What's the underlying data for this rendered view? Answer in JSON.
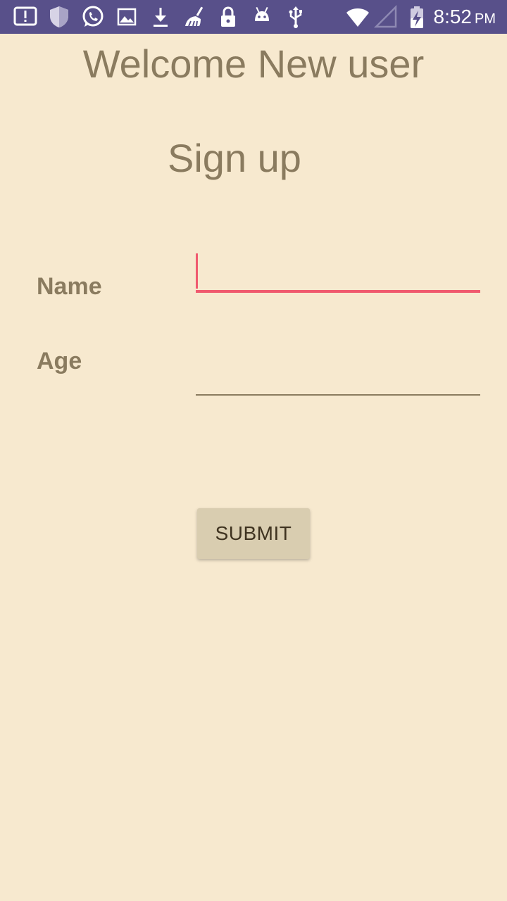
{
  "status_bar": {
    "icons": [
      "alert-icon",
      "shield-icon",
      "whatsapp-icon",
      "image-icon",
      "download-icon",
      "cleaner-icon",
      "lock-icon",
      "android-icon",
      "usb-icon",
      "wifi-icon",
      "signal-icon",
      "battery-charging-icon"
    ],
    "time": "8:52",
    "ampm": "PM"
  },
  "header": {
    "welcome": "Welcome New user",
    "signup": "Sign up"
  },
  "form": {
    "name_label": "Name",
    "name_value": "",
    "age_label": "Age",
    "age_value": "",
    "submit_label": "SUBMIT"
  },
  "colors": {
    "background": "#f7e9cf",
    "status_bar": "#58508a",
    "text": "#8a7b5f",
    "focus_accent": "#f05a6e",
    "button": "#d9cdb0"
  }
}
